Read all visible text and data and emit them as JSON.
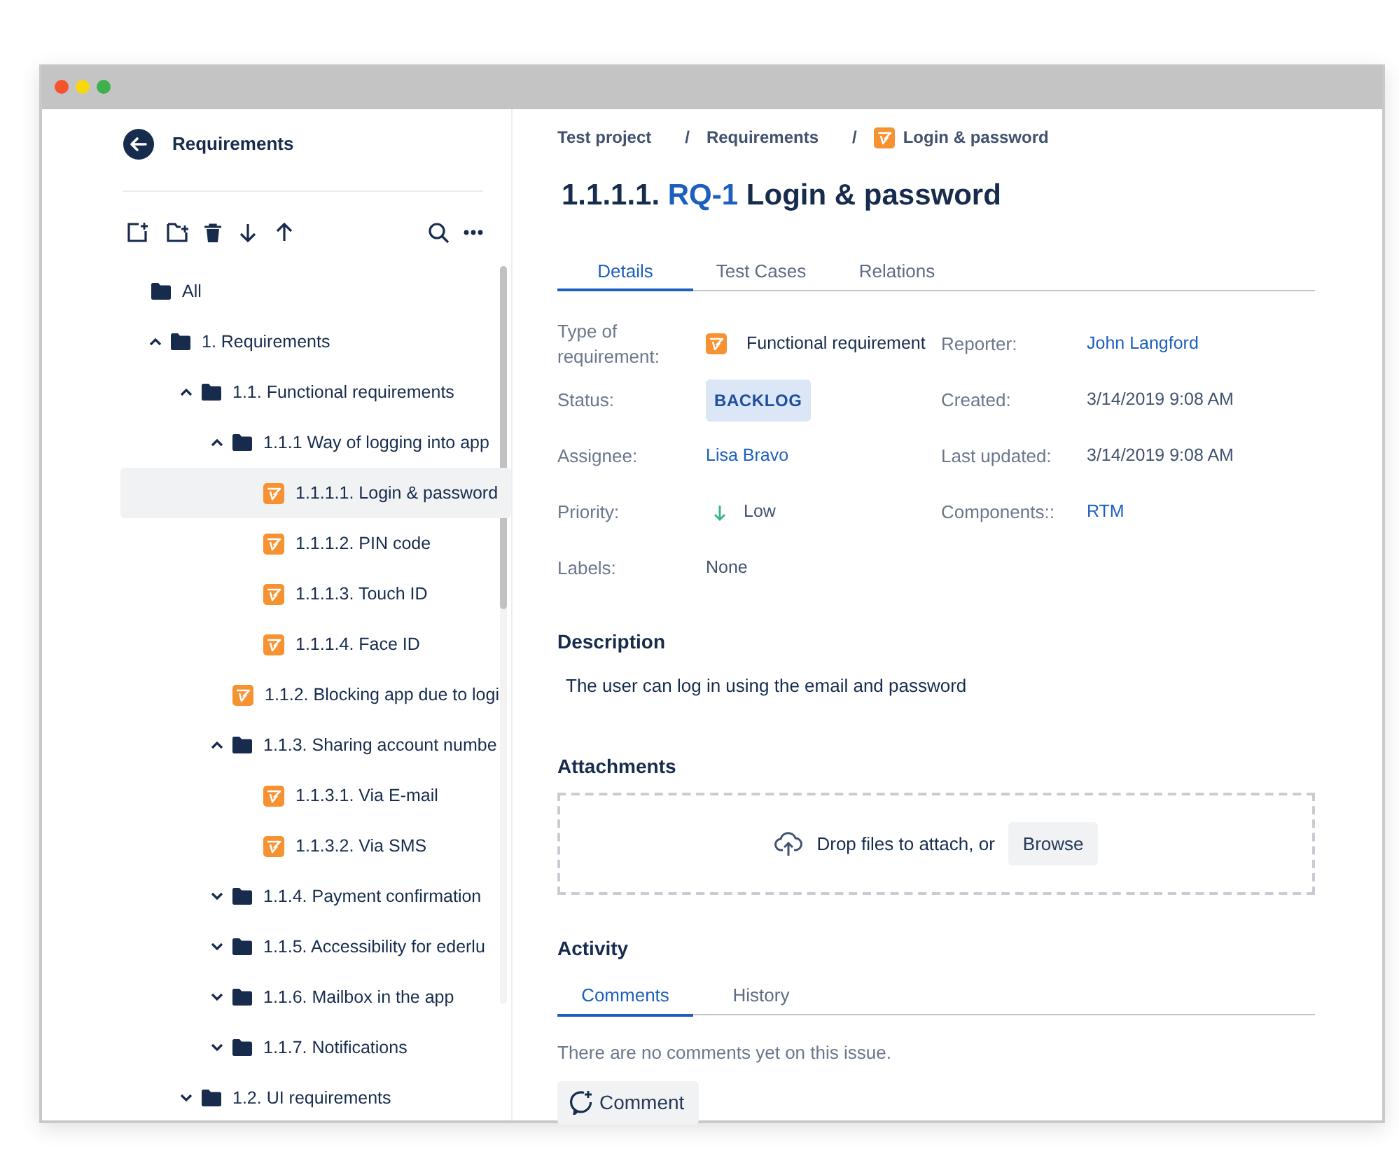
{
  "sidebar": {
    "title": "Requirements",
    "tree": [
      {
        "label": "All",
        "kind": "folder",
        "selected": false,
        "children": [
          {
            "label": "1. Requirements",
            "kind": "folder",
            "expanded": true,
            "selected": false,
            "children": [
              {
                "label": "1.1. Functional requirements",
                "kind": "folder",
                "expanded": true,
                "selected": false,
                "children": [
                  {
                    "label": "1.1.1 Way of logging into app",
                    "kind": "folder",
                    "expanded": true,
                    "selected": false,
                    "children": [
                      {
                        "label": "1.1.1.1. Login & password",
                        "kind": "requirement",
                        "selected": true
                      },
                      {
                        "label": "1.1.1.2. PIN code",
                        "kind": "requirement",
                        "selected": false
                      },
                      {
                        "label": "1.1.1.3. Touch ID",
                        "kind": "requirement",
                        "selected": false
                      },
                      {
                        "label": "1.1.1.4. Face ID",
                        "kind": "requirement",
                        "selected": false
                      }
                    ]
                  },
                  {
                    "label": "1.1.2. Blocking app due to logi",
                    "kind": "requirement",
                    "selected": false
                  },
                  {
                    "label": "1.1.3. Sharing account numbe",
                    "kind": "folder",
                    "expanded": true,
                    "selected": false,
                    "children": [
                      {
                        "label": "1.1.3.1. Via E-mail",
                        "kind": "requirement",
                        "selected": false
                      },
                      {
                        "label": "1.1.3.2. Via SMS",
                        "kind": "requirement",
                        "selected": false
                      }
                    ]
                  },
                  {
                    "label": "1.1.4. Payment confirmation",
                    "kind": "folder",
                    "expanded": false,
                    "selected": false
                  },
                  {
                    "label": "1.1.5. Accessibility for ederlu",
                    "kind": "folder",
                    "expanded": false,
                    "selected": false
                  },
                  {
                    "label": "1.1.6. Mailbox in the app",
                    "kind": "folder",
                    "expanded": false,
                    "selected": false
                  },
                  {
                    "label": "1.1.7. Notifications",
                    "kind": "folder",
                    "expanded": false,
                    "selected": false
                  }
                ]
              },
              {
                "label": "1.2. UI requirements",
                "kind": "folder",
                "expanded": false,
                "selected": false
              }
            ]
          }
        ]
      }
    ]
  },
  "breadcrumb": [
    {
      "label": "Test project",
      "kind": "text"
    },
    {
      "separator": "/",
      "label": "Requirements",
      "kind": "text"
    },
    {
      "separator": "/",
      "label": "Login & password",
      "kind": "requirement"
    }
  ],
  "issue": {
    "number": "1.1.1.1.",
    "key": "RQ-1",
    "title": "Login & password"
  },
  "tabs": [
    {
      "label": "Details",
      "selected": true
    },
    {
      "label": "Test Cases",
      "selected": false
    },
    {
      "label": "Relations",
      "selected": false
    }
  ],
  "fields": [
    {
      "label": "Type of requirement:",
      "value": "Functional requirement",
      "kind": "type"
    },
    {
      "label": "Reporter:",
      "value": "John Langford",
      "kind": "link"
    },
    {
      "label": "Status:",
      "value": "BACKLOG",
      "kind": "status"
    },
    {
      "label": "Created:",
      "value": "3/14/2019 9:08 AM",
      "kind": "text"
    },
    {
      "label": "Assignee:",
      "value": "Lisa Bravo",
      "kind": "link"
    },
    {
      "label": "Last updated:",
      "value": "3/14/2019 9:08 AM",
      "kind": "text"
    },
    {
      "label": "Priority:",
      "value": "Low",
      "kind": "priority"
    },
    {
      "label": "Components::",
      "value": "RTM",
      "kind": "link"
    },
    {
      "label": "Labels:",
      "value": "None",
      "kind": "text"
    }
  ],
  "description": {
    "heading": "Description",
    "text": "The user can log in using the email and password"
  },
  "attachments": {
    "heading": "Attachments",
    "prompt": "Drop files to attach, or",
    "button": "Browse"
  },
  "activity": {
    "heading": "Activity",
    "tabs": [
      {
        "label": "Comments",
        "selected": true
      },
      {
        "label": "History",
        "selected": false
      }
    ],
    "empty_text": "There are no comments yet on this issue.",
    "button": "Comment"
  }
}
